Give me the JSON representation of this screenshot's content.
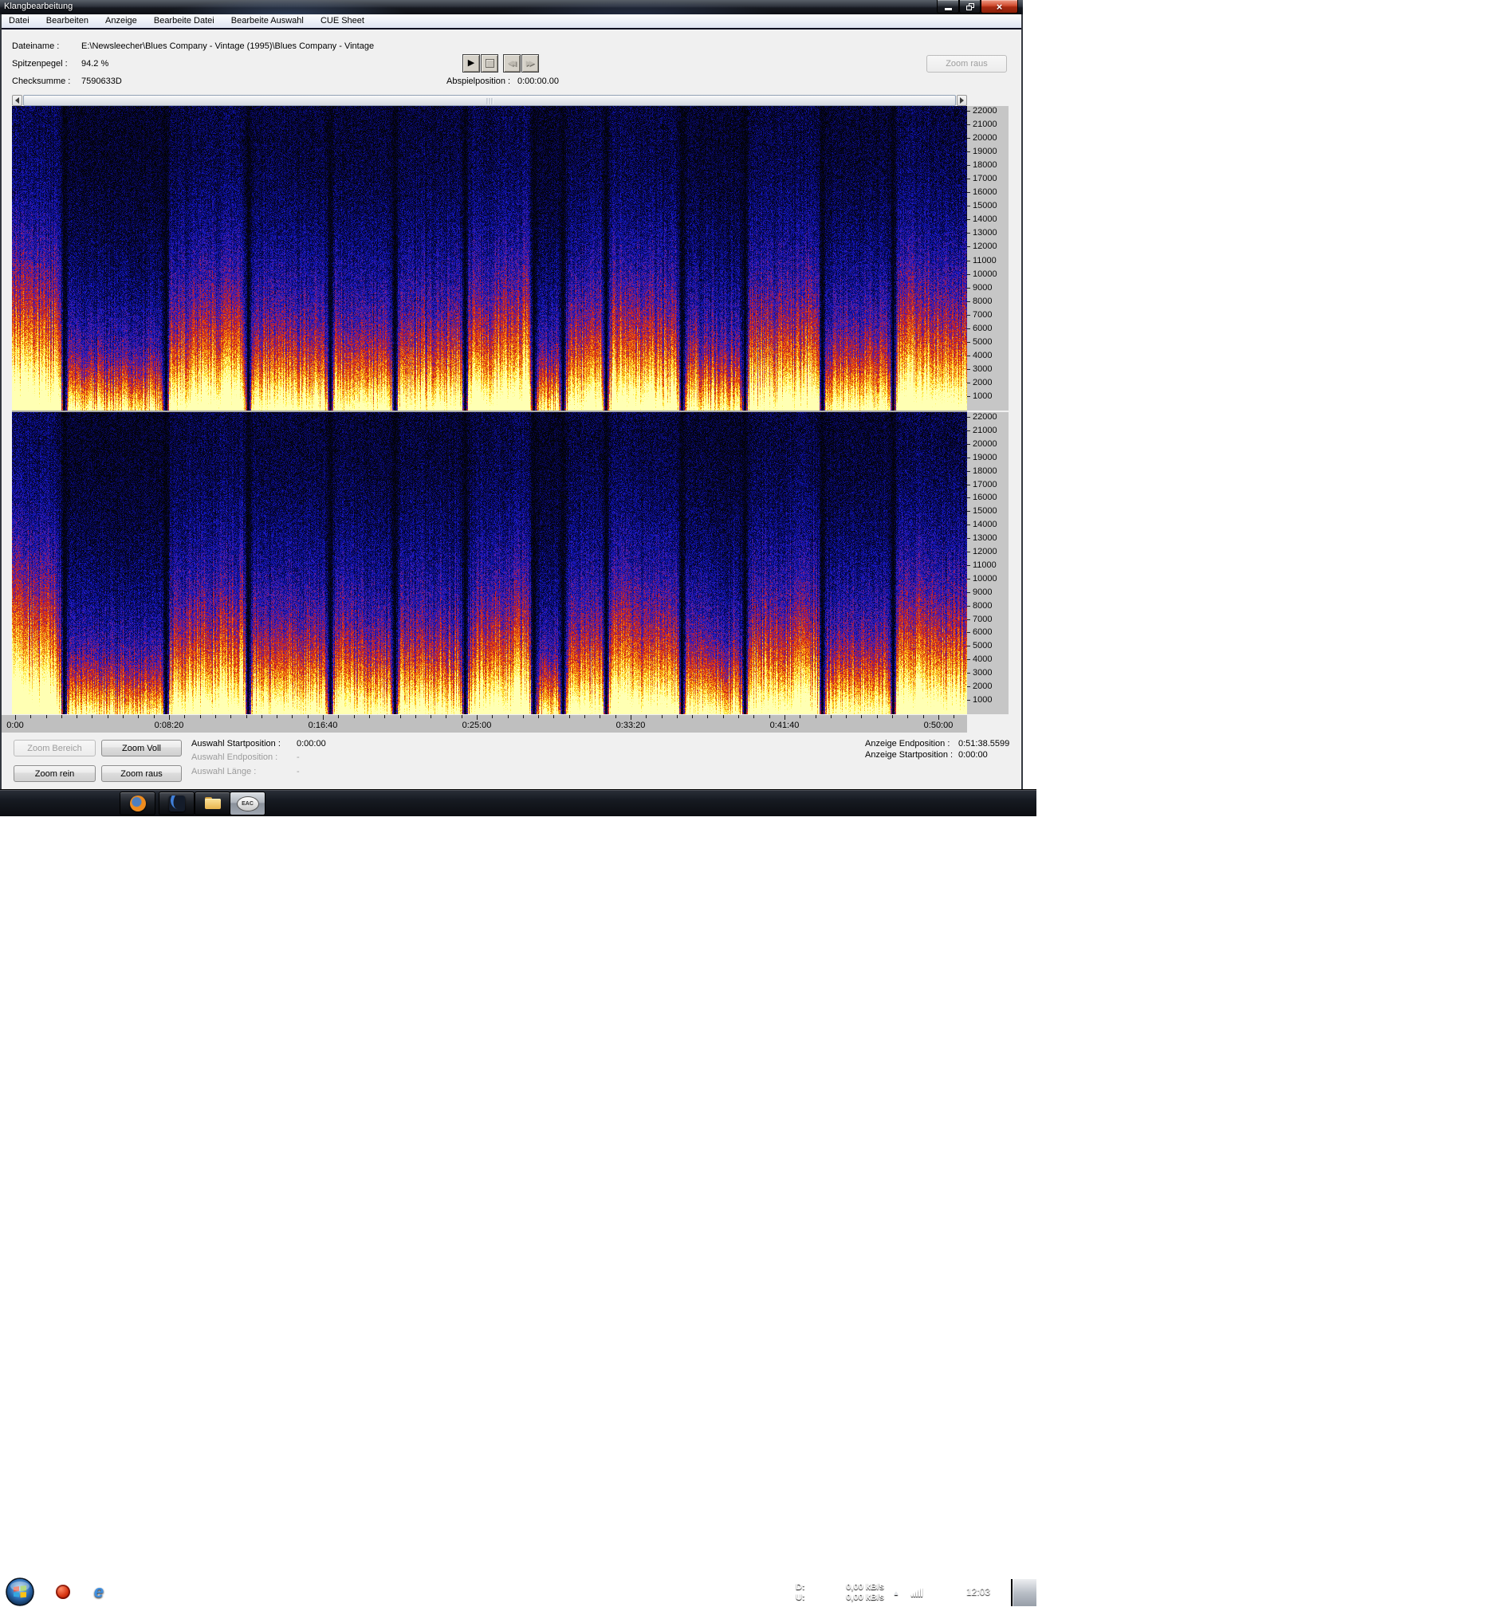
{
  "window": {
    "title": "Klangbearbeitung"
  },
  "menu": {
    "items": [
      "Datei",
      "Bearbeiten",
      "Anzeige",
      "Bearbeite Datei",
      "Bearbeite Auswahl",
      "CUE Sheet"
    ]
  },
  "info": {
    "rows": [
      {
        "label": "Dateiname :",
        "value": "E:\\Newsleecher\\Blues Company - Vintage (1995)\\Blues Company - Vintage"
      },
      {
        "label": "Spitzenpegel :",
        "value": "94.2 %"
      },
      {
        "label": "Checksumme :",
        "value": "7590633D"
      }
    ],
    "play_position_label": "Abspielposition :",
    "play_position": "0:00:00.00",
    "zoom_out_button": "Zoom raus"
  },
  "spectrogram": {
    "freq_labels": [
      "22000",
      "21000",
      "20000",
      "19000",
      "18000",
      "17000",
      "16000",
      "15000",
      "14000",
      "13000",
      "12000",
      "11000",
      "10000",
      "9000",
      "8000",
      "7000",
      "6000",
      "5000",
      "4000",
      "3000",
      "2000",
      "1000"
    ],
    "time_labels": [
      "0:00",
      "0:08:20",
      "0:16:40",
      "0:25:00",
      "0:33:20",
      "0:41:40",
      "0:50:00"
    ],
    "seconds_per_major_tick": 500,
    "track_gaps": [
      0.054,
      0.161,
      0.247,
      0.333,
      0.401,
      0.474,
      0.546,
      0.577,
      0.622,
      0.701,
      0.767,
      0.848,
      0.922
    ],
    "track_levels": [
      1.2,
      0.55,
      0.9,
      0.7,
      0.75,
      0.9,
      1.0,
      0.45,
      0.75,
      0.9,
      0.7,
      1.0,
      0.65,
      0.9
    ],
    "palette": [
      "#030308",
      "#08085a",
      "#1219c8",
      "#78208c",
      "#c81919",
      "#eb5a0f",
      "#fab414",
      "#fff046",
      "#ffffb4"
    ]
  },
  "selection": {
    "rows": [
      {
        "label": "Auswahl Startposition :",
        "value": "0:00:00",
        "enabled": true
      },
      {
        "label": "Auswahl Endposition :",
        "value": "-",
        "enabled": false
      },
      {
        "label": "Auswahl Länge :",
        "value": "-",
        "enabled": false
      }
    ]
  },
  "view": {
    "rows": [
      {
        "label": "Anzeige Endposition :",
        "value": "0:51:38.5599"
      },
      {
        "label": "Anzeige Startposition :",
        "value": "0:00:00"
      }
    ]
  },
  "zoom_buttons": {
    "bereich": "Zoom Bereich",
    "voll": "Zoom Voll",
    "rein": "Zoom rein",
    "raus": "Zoom raus"
  },
  "taskbar": {
    "tray": {
      "down_label": "D:",
      "down_value": "0,00 kB/s",
      "up_label": "U:",
      "up_value": "0,00 kB/s",
      "clock": "12:03",
      "eac_label": "EAC",
      "ie_glyph": "e"
    }
  }
}
